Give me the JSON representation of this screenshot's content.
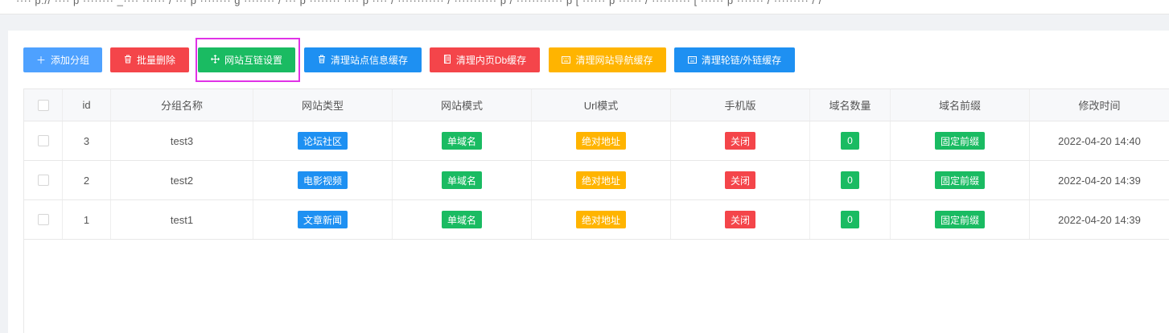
{
  "top_strip_text": "···· p:// ···· p ········ _···· ······ / ··· p ········ g ········ / ··· p ········ ···· p ···· / ············ / ··········· p / ············ p [ ······ p ······ / ·········· [ ······ p ······· / ········· / /",
  "toolbar": {
    "add_group": "添加分组",
    "batch_delete": "批量删除",
    "link_settings": "网站互链设置",
    "clear_site_cache": "清理站点信息缓存",
    "clear_inner_db_cache": "清理内页Db缓存",
    "clear_nav_cache": "清理网站导航缓存",
    "clear_carousel_cache": "清理轮链/外链缓存"
  },
  "table": {
    "headers": {
      "id": "id",
      "group_name": "分组名称",
      "site_type": "网站类型",
      "site_mode": "网站模式",
      "url_mode": "Url模式",
      "mobile": "手机版",
      "domain_count": "域名数量",
      "domain_prefix": "域名前缀",
      "modified_time": "修改时间"
    },
    "rows": [
      {
        "id": "3",
        "group_name": "test3",
        "site_type": "论坛社区",
        "site_mode": "单域名",
        "url_mode": "绝对地址",
        "mobile": "关闭",
        "domain_count": "0",
        "domain_prefix": "固定前缀",
        "modified_time": "2022-04-20 14:40"
      },
      {
        "id": "2",
        "group_name": "test2",
        "site_type": "电影视频",
        "site_mode": "单域名",
        "url_mode": "绝对地址",
        "mobile": "关闭",
        "domain_count": "0",
        "domain_prefix": "固定前缀",
        "modified_time": "2022-04-20 14:39"
      },
      {
        "id": "1",
        "group_name": "test1",
        "site_type": "文章新闻",
        "site_mode": "单域名",
        "url_mode": "绝对地址",
        "mobile": "关闭",
        "domain_count": "0",
        "domain_prefix": "固定前缀",
        "modified_time": "2022-04-20 14:39"
      }
    ]
  },
  "colors": {
    "blue_light": "#4ea1ff",
    "red": "#f4454a",
    "green": "#1abb62",
    "blue": "#1e90f2",
    "orange": "#ffb400",
    "highlight": "#e032e6"
  }
}
